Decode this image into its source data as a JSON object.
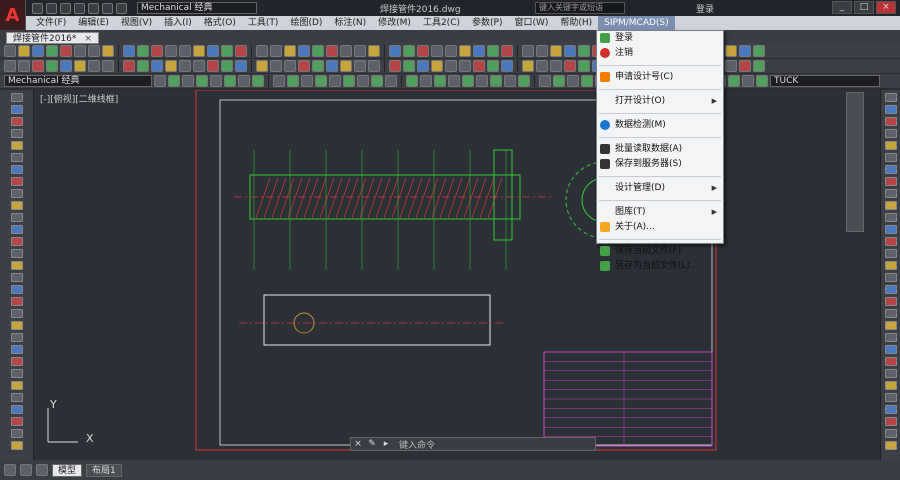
{
  "app": {
    "logo": "A",
    "workspace": "Mechanical 经典",
    "document_title": "焊接管件2016.dwg",
    "search_placeholder": "键入关键字或短语",
    "login": "登录"
  },
  "menu": [
    "文件(F)",
    "编辑(E)",
    "视图(V)",
    "插入(I)",
    "格式(O)",
    "工具(T)",
    "绘图(D)",
    "标注(N)",
    "修改(M)",
    "工具2(C)",
    "参数(P)",
    "窗口(W)",
    "帮助(H)",
    "SIPM/MCAD(S)"
  ],
  "active_menu": "SIPM/MCAD(S)",
  "file_tab": "焊接管件2016*",
  "toolbar": {
    "workspace_combo": "Mechanical 经典",
    "tuck_field": "TUCK"
  },
  "dropdown": [
    {
      "label": "登录",
      "icon": "user-icon"
    },
    {
      "label": "注销",
      "icon": "power-icon"
    },
    {
      "sep": true
    },
    {
      "label": "申请设计号(C)",
      "icon": "edit-icon"
    },
    {
      "sep": true
    },
    {
      "label": "打开设计(O)",
      "icon": "",
      "submenu": true
    },
    {
      "sep": true
    },
    {
      "label": "数据检测(M)",
      "icon": "gear-icon"
    },
    {
      "sep": true
    },
    {
      "label": "批量读取数据(A)",
      "icon": "save-icon"
    },
    {
      "label": "保存到服务器(S)",
      "icon": "save-icon"
    },
    {
      "sep": true
    },
    {
      "label": "设计管理(D)",
      "icon": "",
      "submenu": true
    },
    {
      "sep": true
    },
    {
      "label": "图库(T)",
      "icon": "",
      "submenu": true
    },
    {
      "label": "关于(A)...",
      "icon": "help-icon"
    },
    {
      "sep": true
    },
    {
      "label": "保存当前文件(F)",
      "icon": "file-icon"
    },
    {
      "label": "另存为当前文件(L)...",
      "icon": "file-icon"
    }
  ],
  "canvas": {
    "viewport_label": "[-][俯视][二维线框]",
    "axis_y": "Y",
    "axis_x": "X",
    "background": "#2b2f36"
  },
  "command": {
    "placeholder": "键入命令"
  },
  "layout_tabs": [
    "模型",
    "布局1"
  ]
}
